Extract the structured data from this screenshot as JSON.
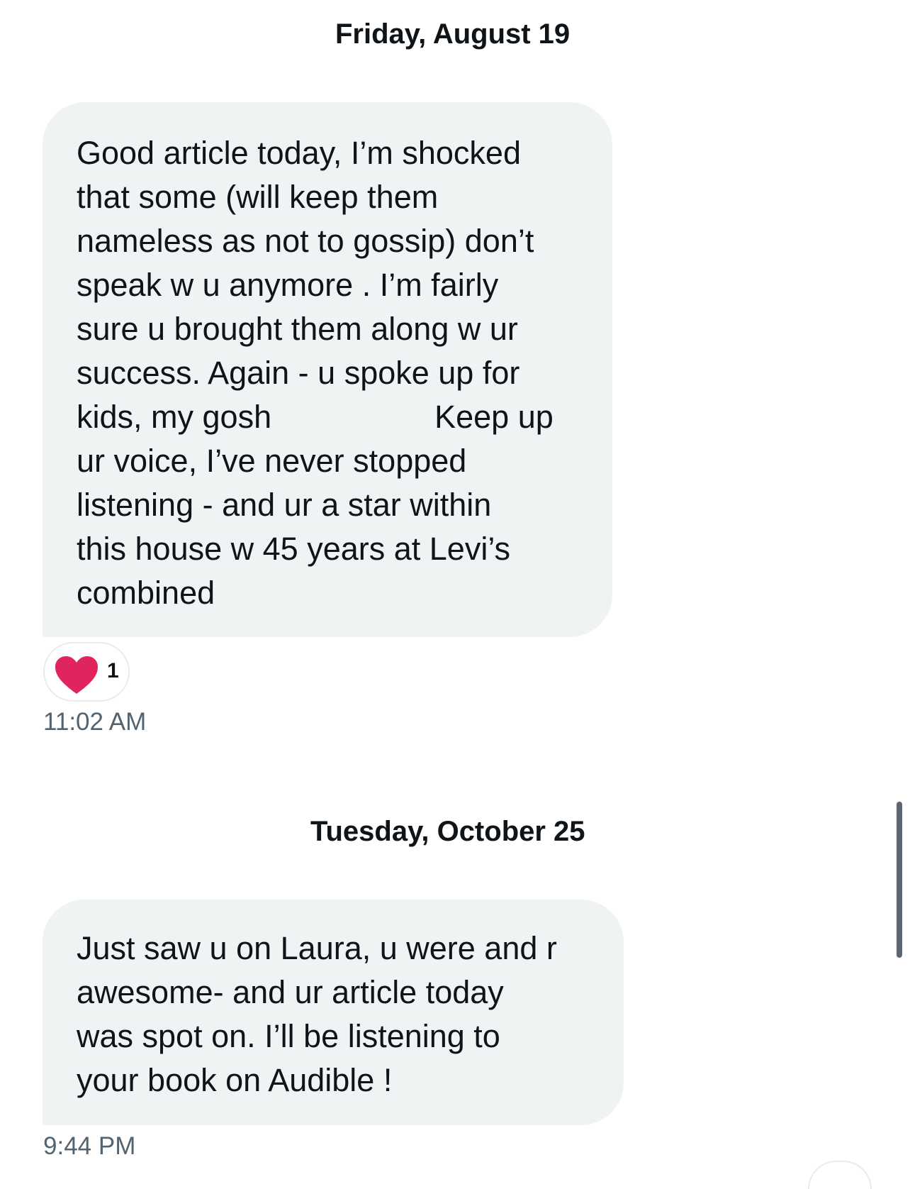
{
  "conversation": {
    "sections": [
      {
        "date": "Friday, August 19",
        "message": {
          "lines": [
            "Good article today, I’m shocked",
            "that some (will keep them",
            "nameless as not to gossip) don’t",
            "speak w u anymore . I’m fairly",
            "sure u brought them along w ur",
            "success. Again - u spoke up for",
            "kids, my gosh",
            "Keep up",
            "ur voice, I’ve never stopped",
            "listening - and ur a star within",
            "this house w 45 years at Levi’s",
            "combined"
          ],
          "reaction": {
            "icon": "heart-icon",
            "count": "1",
            "color": "#e0245e"
          },
          "time": "11:02 AM"
        }
      },
      {
        "date": "Tuesday, October 25",
        "message": {
          "lines": [
            "Just saw u on Laura, u were and r",
            "awesome- and ur article today",
            "was spot on. I’ll be listening to",
            "your book on Audible !"
          ],
          "time": "9:44 PM"
        }
      }
    ]
  },
  "colors": {
    "bubble_background": "#eff3f4",
    "text": "#0f1419",
    "timestamp": "#536471",
    "heart": "#e0245e"
  }
}
